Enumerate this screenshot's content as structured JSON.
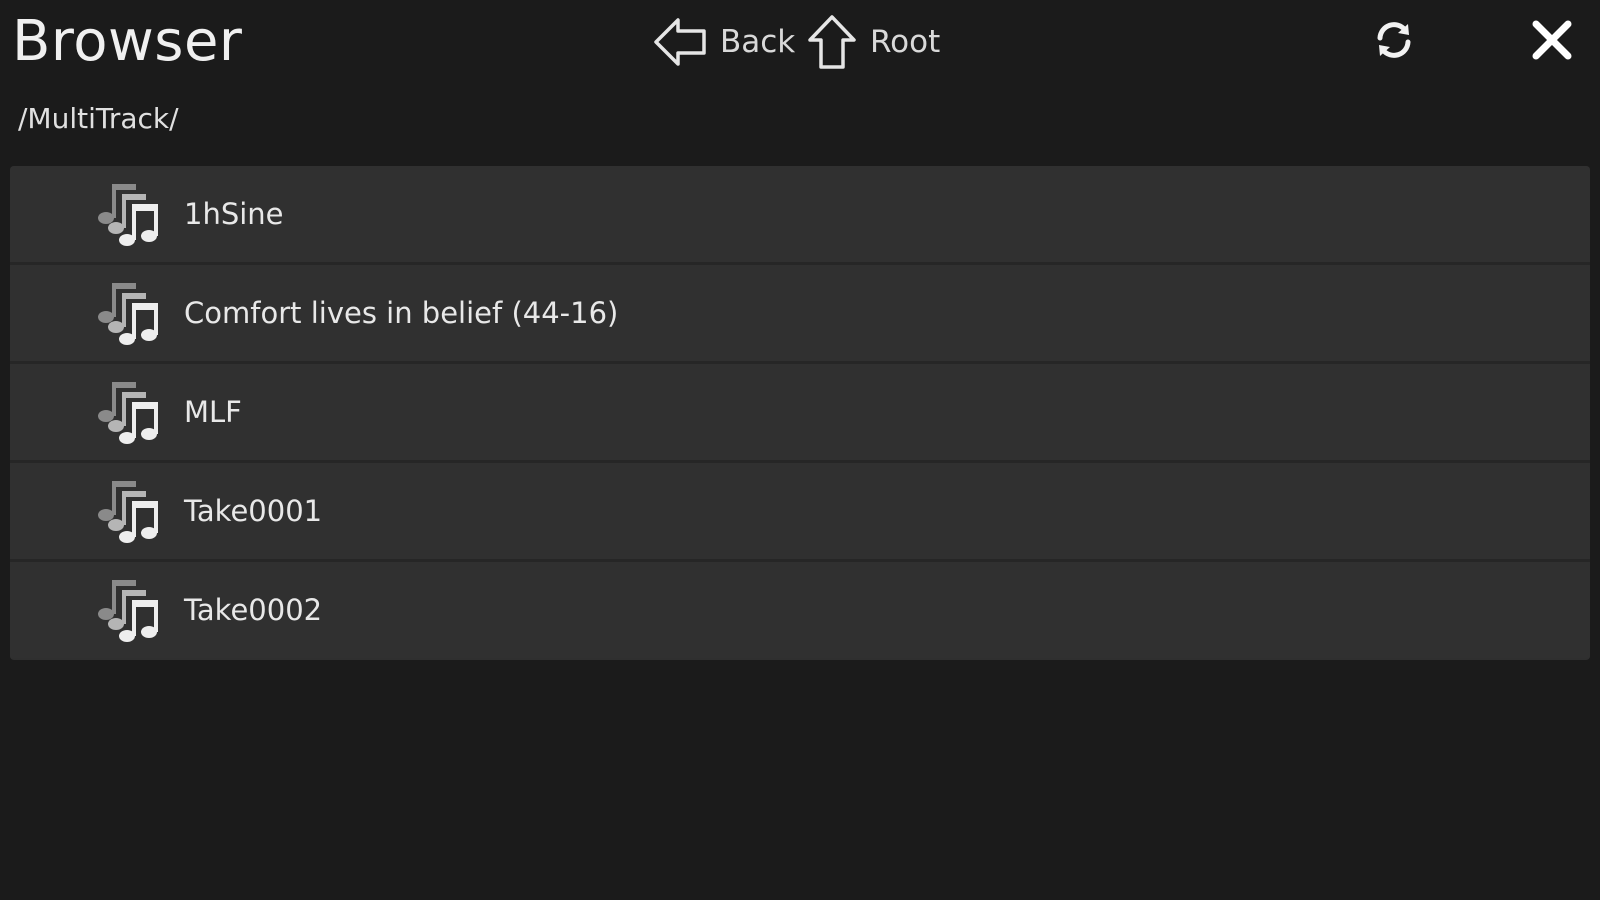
{
  "header": {
    "title": "Browser",
    "back_label": "Back",
    "root_label": "Root",
    "icons": {
      "back": "back-arrow-icon",
      "root": "up-arrow-icon",
      "refresh": "refresh-icon",
      "close": "close-icon"
    }
  },
  "path": "/MultiTrack/",
  "files": [
    {
      "name": "1hSine",
      "icon": "music-notes-icon"
    },
    {
      "name": "Comfort lives in belief (44-16)",
      "icon": "music-notes-icon"
    },
    {
      "name": "MLF",
      "icon": "music-notes-icon"
    },
    {
      "name": "Take0001",
      "icon": "music-notes-icon"
    },
    {
      "name": "Take0002",
      "icon": "music-notes-icon"
    }
  ],
  "colors": {
    "background": "#1b1b1b",
    "list_row": "#303030",
    "row_divider": "#262626",
    "text": "#e8e8e8"
  }
}
